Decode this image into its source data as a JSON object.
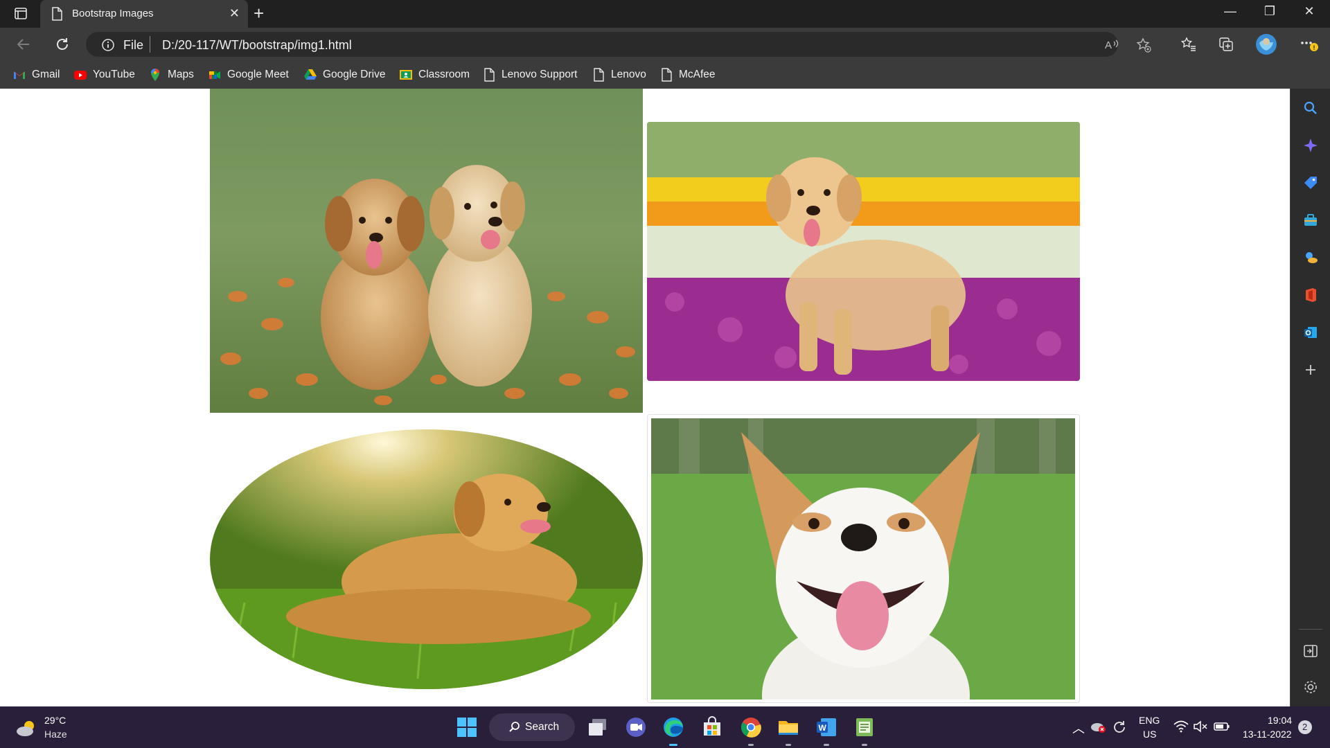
{
  "browser": {
    "tab_title": "Bootstrap Images",
    "address_scheme": "File",
    "address_url": "D:/20-117/WT/bootstrap/img1.html"
  },
  "bookmarks": [
    {
      "label": "Gmail",
      "icon": "gmail-icon"
    },
    {
      "label": "YouTube",
      "icon": "youtube-icon"
    },
    {
      "label": "Maps",
      "icon": "maps-icon"
    },
    {
      "label": "Google Meet",
      "icon": "google-meet-icon"
    },
    {
      "label": "Google Drive",
      "icon": "google-drive-icon"
    },
    {
      "label": "Classroom",
      "icon": "classroom-icon"
    },
    {
      "label": "Lenovo Support",
      "icon": "page-icon"
    },
    {
      "label": "Lenovo",
      "icon": "page-icon"
    },
    {
      "label": "McAfee",
      "icon": "page-icon"
    }
  ],
  "page": {
    "images": [
      {
        "name": "two-golden-retriever-puppies",
        "style": "plain"
      },
      {
        "name": "golden-retriever-in-flowers",
        "style": "rounded"
      },
      {
        "name": "golden-retriever-lying-in-grass",
        "style": "rounded-circle"
      },
      {
        "name": "smiling-white-dog",
        "style": "thumbnail"
      }
    ]
  },
  "taskbar": {
    "weather_temp": "29°C",
    "weather_condition": "Haze",
    "search_label": "Search",
    "lang_primary": "ENG",
    "lang_region": "US",
    "time": "19:04",
    "date": "13-11-2022",
    "notification_count": "2"
  },
  "colors": {
    "titlebar": "#202020",
    "toolbar": "#3b3b3b",
    "taskbar": "#2a1f3a",
    "accent": "#0078d4"
  }
}
